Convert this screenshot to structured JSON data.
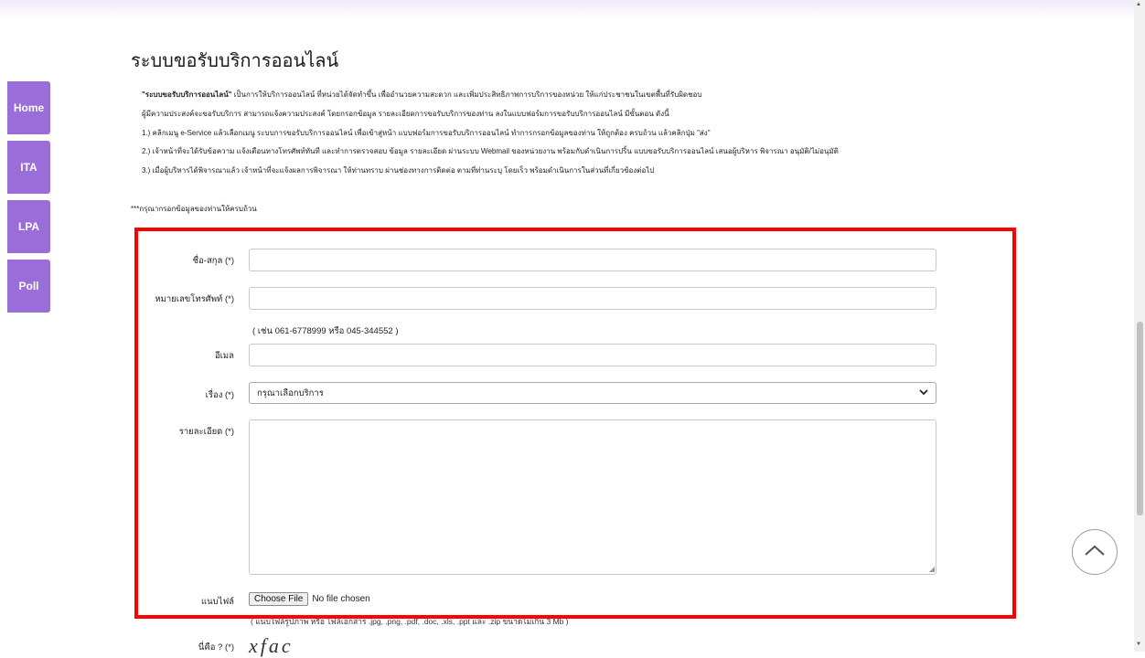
{
  "page": {
    "title": "ระบบขอรับบริการออนไลน์"
  },
  "sidebar": {
    "items": [
      {
        "label": "Home"
      },
      {
        "label": "ITA"
      },
      {
        "label": "LPA"
      },
      {
        "label": "Poll"
      }
    ]
  },
  "intro": {
    "line1_bold": "\"ระบบขอรับบริการออนไลน์\"",
    "line1_rest": " เป็นการให้บริการออนไลน์ ที่หน่วยได้จัดทำขึ้น เพื่ออำนวยความสะดวก และเพิ่มประสิทธิภาพการบริการของหน่วย ให้แก่ประชาชนในเขตพื้นที่รับผิดชอบ",
    "line2": "ผู้มีความประสงค์จะขอรับบริการ สามารถแจ้งความประสงค์ โดยกรอกข้อมูล รายละเอียดการขอรับบริการของท่าน ลงในแบบฟอร์มการขอรับบริการออนไลน์ มีขั้นตอน ดังนี้",
    "line3": "1.) คลิกเมนู e-Service แล้วเลือกเมนู ระบบการขอรับบริการออนไลน์ เพื่อเข้าสู่หน้า แบบฟอร์มการขอรับบริการออนไลน์ ทำการกรอกข้อมูลของท่าน ให้ถูกต้อง ครบถ้วน แล้วคลิกปุ่ม \"ส่ง\"",
    "line4": "2.) เจ้าหน้าที่จะได้รับข้อความ แจ้งเตือนทางโทรศัพท์ทันที และทำการตรวจสอบ ข้อมูล รายละเอียด ผ่านระบบ Webmail ของหน่วยงาน พร้อมกับดำเนินการปริ้น แบบขอรับบริการออนไลน์ เสนอผู้บริหาร พิจารณา อนุมัติ/ไม่อนุมัติ",
    "line5": "3.) เมื่อผู้บริหารได้พิจารณาแล้ว เจ้าหน้าที่จะแจ้งผลการพิจารณา ให้ท่านทราบ ผ่านช่องทางการติดต่อ ตามที่ท่านระบุ โดยเร็ว พร้อมดำเนินการในส่วนที่เกี่ยวข้องต่อไป",
    "note": "***กรุณากรอกข้อมูลของท่านให้ครบถ้วน"
  },
  "form": {
    "name_label": "ชื่อ-สกุล (*)",
    "name_value": "",
    "phone_label": "หมายเลขโทรศัพท์ (*)",
    "phone_value": "",
    "phone_hint": "( เช่น 061-6778999 หรือ 045-344552 )",
    "email_label": "อีเมล",
    "email_value": "",
    "subject_label": "เรื่อง (*)",
    "subject_selected": "กรุณาเลือกบริการ",
    "detail_label": "รายละเอียด (*)",
    "detail_value": "",
    "file_label": "แนบไฟล์",
    "file_button": "Choose File",
    "file_status": "No file chosen",
    "file_hint": "( แนบไฟล์รูปภาพ หรือ ไฟล์เอกสาร .jpg, .png, .pdf, .doc, .xls, .ppt และ .zip ขนาดไม่เกิน 3 Mb )",
    "captcha_label": "นี่คือ ? (*)",
    "captcha_text": "xfac"
  },
  "colors": {
    "sidebar_bg": "#9a6ed8",
    "highlight_border": "#ff0000"
  },
  "icons": {
    "scroll_top": "chevron-up-icon",
    "select_arrow": "chevron-down-icon"
  }
}
